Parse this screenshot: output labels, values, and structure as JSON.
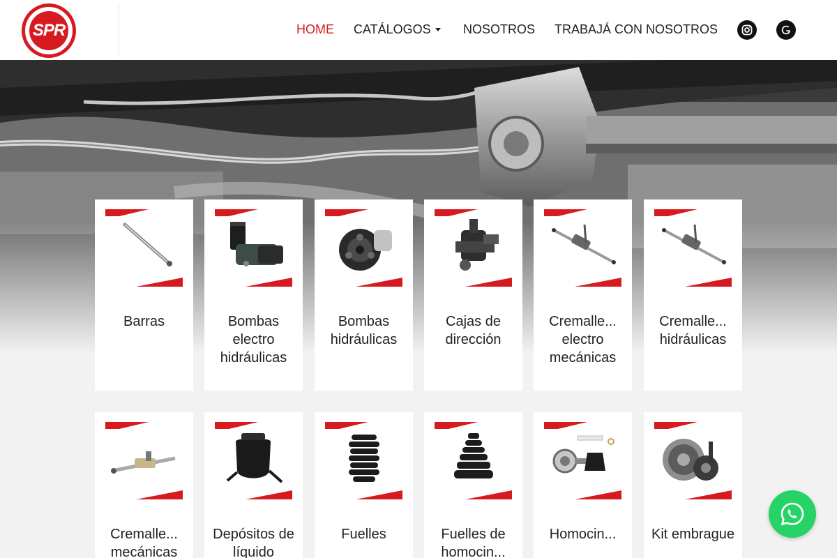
{
  "brand": {
    "logo_text": "SPR"
  },
  "nav": {
    "home": "HOME",
    "catalogos": "CATÁLOGOS",
    "nosotros": "NOSOTROS",
    "trabaja": "TRABAJÁ CON NOSOTROS"
  },
  "social": {
    "instagram_icon": "instagram-icon",
    "google_icon": "google-icon"
  },
  "accent_color": "#d71920",
  "categories": [
    {
      "label": "Barras",
      "icon": "steering-bar"
    },
    {
      "label": "Bombas electro hidráulicas",
      "icon": "electro-hydraulic-pump"
    },
    {
      "label": "Bombas hidráulicas",
      "icon": "hydraulic-pump"
    },
    {
      "label": "Cajas de dirección",
      "icon": "steering-box"
    },
    {
      "label": "Cremalle... electro mecánicas",
      "icon": "steering-rack"
    },
    {
      "label": "Cremalle... hidráulicas",
      "icon": "steering-rack"
    },
    {
      "label": "Cremalle... mecánicas",
      "icon": "mechanical-rack"
    },
    {
      "label": "Depósitos de líquido",
      "icon": "fluid-reservoir"
    },
    {
      "label": "Fuelles",
      "icon": "bellows"
    },
    {
      "label": "Fuelles de homocin...",
      "icon": "cv-boot"
    },
    {
      "label": "Homocin...",
      "icon": "cv-joint"
    },
    {
      "label": "Kit embrague",
      "icon": "clutch-kit"
    }
  ],
  "whatsapp": {
    "icon": "whatsapp-icon"
  }
}
